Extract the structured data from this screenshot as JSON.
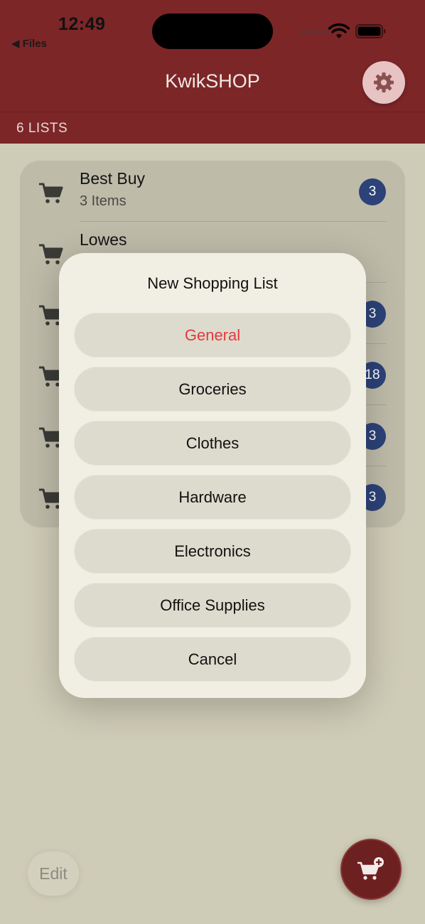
{
  "status_bar": {
    "time": "12:49",
    "back_label": "◀ Files"
  },
  "header": {
    "title": "KwikSHOP",
    "lists_count": "6 LISTS"
  },
  "lists": [
    {
      "name": "Best Buy",
      "subtitle": "3 Items",
      "badge": "3"
    },
    {
      "name": "Lowes",
      "subtitle": "",
      "badge": ""
    },
    {
      "name": "",
      "subtitle": "",
      "badge": "3"
    },
    {
      "name": "",
      "subtitle": "",
      "badge": "18"
    },
    {
      "name": "",
      "subtitle": "",
      "badge": "3"
    },
    {
      "name": "",
      "subtitle": "",
      "badge": "3"
    }
  ],
  "dialog": {
    "title": "New Shopping List",
    "options": [
      {
        "label": "General"
      },
      {
        "label": "Groceries"
      },
      {
        "label": "Clothes"
      },
      {
        "label": "Hardware"
      },
      {
        "label": "Electronics"
      },
      {
        "label": "Office Supplies"
      }
    ],
    "cancel_label": "Cancel"
  },
  "toolbar": {
    "edit_label": "Edit"
  },
  "colors": {
    "header": "#7d2627",
    "background": "#cecbb6",
    "badge": "#2c4278",
    "destructive": "#e5393b",
    "fab": "#6c2020"
  },
  "icons": {
    "settings": "gear-icon",
    "list_item": "cart-icon",
    "new_list": "cart-plus-icon"
  }
}
